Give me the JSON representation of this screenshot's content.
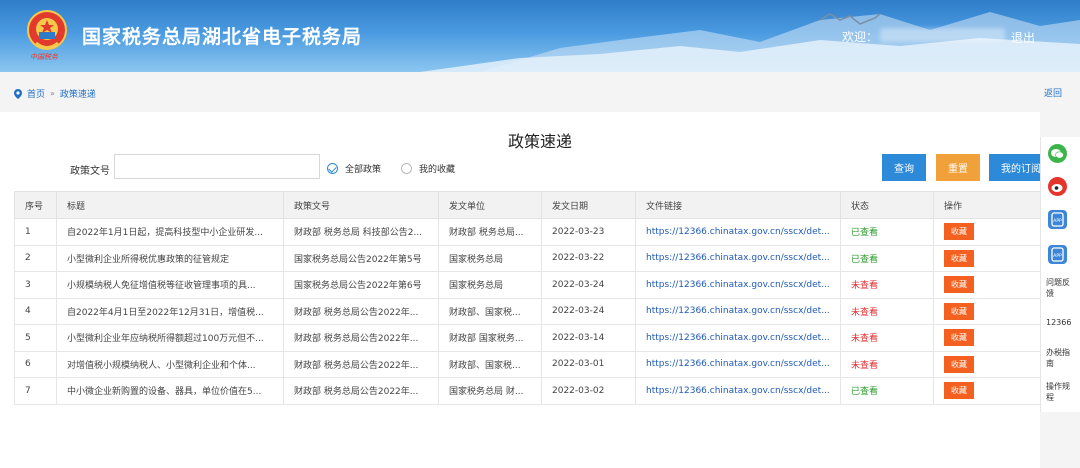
{
  "header": {
    "site_title": "国家税务总局湖北省电子税务局",
    "slogan": "中国税务",
    "welcome": "欢迎：",
    "logout": "退出"
  },
  "breadcrumb": {
    "home": "首页",
    "sep": "»",
    "current": "政策速递",
    "back": "返回"
  },
  "page_title": "政策速递",
  "filter": {
    "doc_no_label": "政策文号",
    "doc_no_value": "",
    "radio_all": "全部政策",
    "radio_fav": "我的收藏",
    "query": "查询",
    "reset": "重置",
    "subscribe": "我的订阅"
  },
  "table": {
    "headers": [
      "序号",
      "标题",
      "政策文号",
      "发文单位",
      "发文日期",
      "文件链接",
      "状态",
      "操作"
    ],
    "rows": [
      [
        "1",
        "自2022年1月1日起，提高科技型中小企业研发...",
        "财政部 税务总局 科技部公告2...",
        "财政部 税务总局...",
        "2022-03-23",
        "https://12366.chinatax.gov.cn/sscx/det...",
        "已查看",
        "收藏"
      ],
      [
        "2",
        "小型微利企业所得税优惠政策的征管规定",
        "国家税务总局公告2022年第5号",
        "国家税务总局",
        "2022-03-22",
        "https://12366.chinatax.gov.cn/sscx/det...",
        "已查看",
        "收藏"
      ],
      [
        "3",
        "小规模纳税人免征增值税等征收管理事项的具...",
        "国家税务总局公告2022年第6号",
        "国家税务总局",
        "2022-03-24",
        "https://12366.chinatax.gov.cn/sscx/det...",
        "未查看",
        "收藏"
      ],
      [
        "4",
        "自2022年4月1日至2022年12月31日，增值税...",
        "财政部 税务总局公告2022年...",
        "财政部、国家税...",
        "2022-03-24",
        "https://12366.chinatax.gov.cn/sscx/det...",
        "未查看",
        "收藏"
      ],
      [
        "5",
        "小型微利企业年应纳税所得额超过100万元但不...",
        "财政部 税务总局公告2022年...",
        "财政部 国家税务...",
        "2022-03-14",
        "https://12366.chinatax.gov.cn/sscx/det...",
        "未查看",
        "收藏"
      ],
      [
        "6",
        "对增值税小规模纳税人、小型微利企业和个体...",
        "财政部 税务总局公告2022年...",
        "财政部、国家税...",
        "2022-03-01",
        "https://12366.chinatax.gov.cn/sscx/det...",
        "未查看",
        "收藏"
      ],
      [
        "7",
        "中小微企业新购置的设备、器具，单位价值在5...",
        "财政部 税务总局公告2022年...",
        "国家税务总局 财...",
        "2022-03-02",
        "https://12366.chinatax.gov.cn/sscx/det...",
        "已查看",
        "收藏"
      ]
    ]
  },
  "sidebar": {
    "items": [
      {
        "icon": "wechat-icon",
        "color": "#3bb54a"
      },
      {
        "icon": "weibo-icon",
        "color": "#e5342c"
      },
      {
        "icon": "app-icon",
        "color": "#3d86d6"
      },
      {
        "icon": "app-icon",
        "color": "#3d86d6"
      }
    ],
    "app_label": "APP",
    "feedback": "问题反馈",
    "hotline": "12366",
    "guide": "办税指南",
    "procedure": "操作规程"
  },
  "colors": {
    "primary": "#2d8ad8",
    "reset": "#f0a13a",
    "favorite": "#f3601f",
    "seen": "#2a9d2a",
    "unseen": "#e02d2d"
  }
}
